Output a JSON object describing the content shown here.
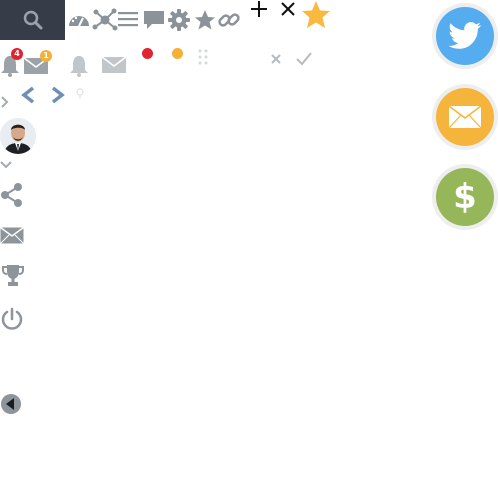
{
  "toolbar": {
    "search_icon": "search-icon",
    "icons": [
      "dashboard-icon",
      "network-icon",
      "list-icon",
      "chat-icon",
      "gear-icon",
      "star-icon",
      "link-icon",
      "plus-icon",
      "close-icon",
      "star-filled-icon"
    ]
  },
  "notifications": {
    "bell_badge": "4",
    "mail_badge": "1"
  },
  "status_colors": {
    "red": "#e0232f",
    "yellow": "#f5b035",
    "badge_red": "#e0232f",
    "badge_yellow": "#f5b035"
  },
  "social": {
    "twitter_color": "#55acee",
    "mail_color": "#f5b43c",
    "money_color": "#95b75a",
    "money_symbol": "$"
  },
  "sidebar_icons": [
    "share-icon",
    "mail-icon",
    "trophy-icon",
    "power-icon",
    "back-icon"
  ]
}
